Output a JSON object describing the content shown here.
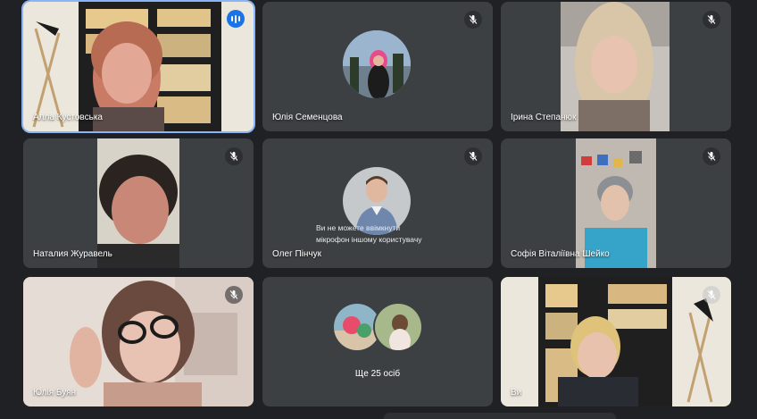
{
  "participants": [
    {
      "name": "Алла Кустовська"
    },
    {
      "name": "Юлія Семенцова"
    },
    {
      "name": "Ірина Степанюк"
    },
    {
      "name": "Наталия Журавель"
    },
    {
      "name": "Олег Пінчук"
    },
    {
      "name": "Софія Віталіївна Шейко"
    },
    {
      "name": "Юлія Буян"
    },
    {
      "name": "Ви"
    }
  ],
  "tooltip": {
    "line1": "Ви не можете ввімкнути",
    "line2": "мікрофон іншому користувачу"
  },
  "more": {
    "label": "Ще 25 осіб"
  },
  "icons": {
    "mic_off": "mic-off-icon",
    "speaking": "audio-level-icon"
  },
  "colors": {
    "background": "#202124",
    "tile": "#3c4043",
    "active_border": "#8ab4f8",
    "speaking_badge": "#1a73e8"
  }
}
